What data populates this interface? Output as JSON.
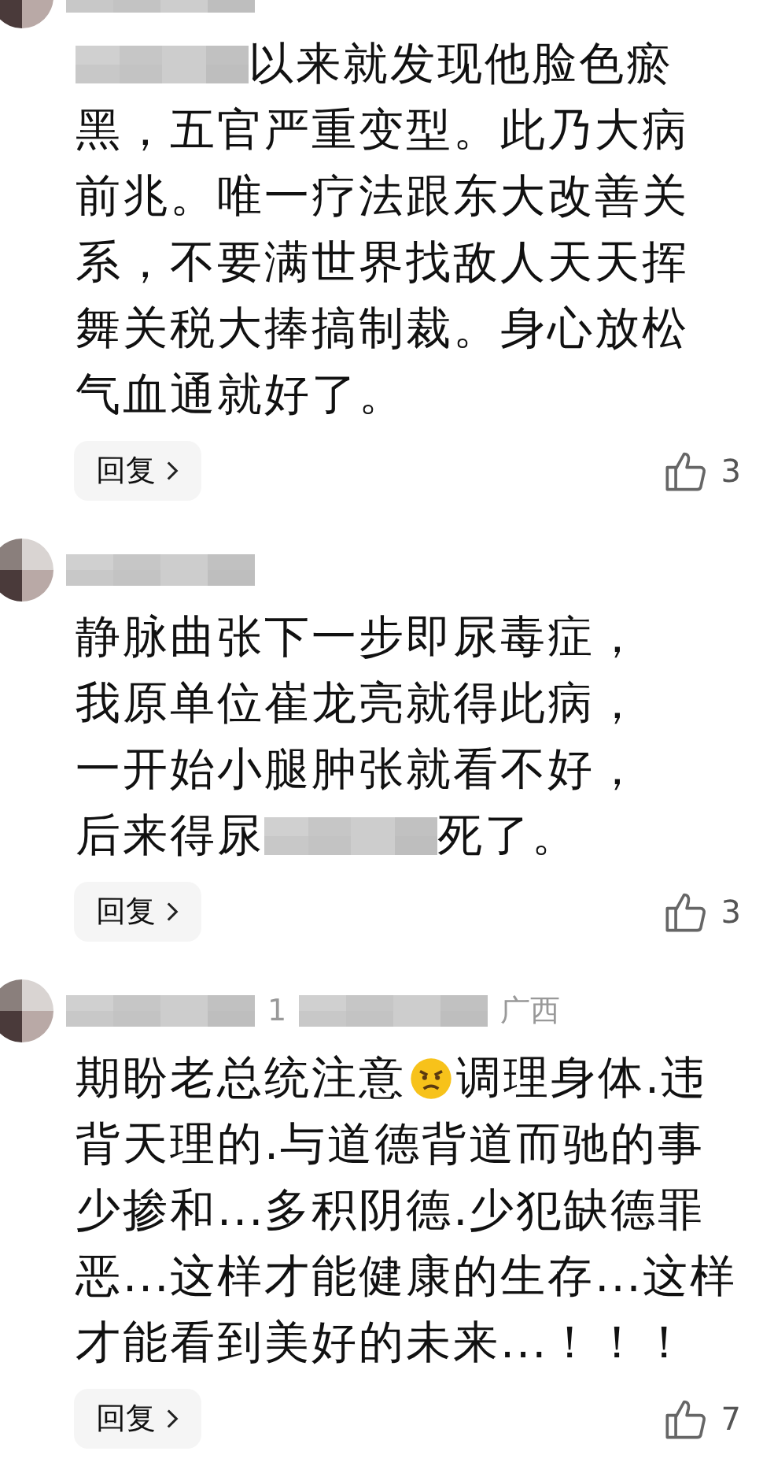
{
  "comments": [
    {
      "header": [
        {
          "kind": "blur"
        }
      ],
      "lines": [
        [
          {
            "kind": "blur"
          },
          {
            "kind": "text",
            "text": "以来就发现他脸色瘀"
          }
        ],
        [
          {
            "kind": "text",
            "text": "黑，五官严重变型。此乃大病"
          }
        ],
        [
          {
            "kind": "text",
            "text": "前兆。唯一疗法跟东大改善关"
          }
        ],
        [
          {
            "kind": "text",
            "text": "系，不要满世界找敌人天天挥"
          }
        ],
        [
          {
            "kind": "text",
            "text": "舞关税大捧搞制裁。身心放松"
          }
        ],
        [
          {
            "kind": "text",
            "text": "气血通就好了。"
          }
        ]
      ],
      "reply": "回复",
      "likes": "3"
    },
    {
      "header": [
        {
          "kind": "blur"
        }
      ],
      "lines": [
        [
          {
            "kind": "text",
            "text": "静脉曲张下一步即尿毒症，"
          }
        ],
        [
          {
            "kind": "text",
            "text": "我原单位崔龙亮就得此病，"
          }
        ],
        [
          {
            "kind": "text",
            "text": "一开始小腿肿张就看不好，"
          }
        ],
        [
          {
            "kind": "text",
            "text": "后来得尿"
          },
          {
            "kind": "blur"
          },
          {
            "kind": "text",
            "text": "死了。"
          }
        ]
      ],
      "reply": "回复",
      "likes": "3"
    },
    {
      "header": [
        {
          "kind": "blur"
        },
        {
          "kind": "text",
          "text": "1"
        },
        {
          "kind": "blur"
        },
        {
          "kind": "text",
          "text": "广西"
        }
      ],
      "lines": [
        [
          {
            "kind": "text",
            "text": "期盼老总统注意"
          },
          {
            "kind": "emoji"
          },
          {
            "kind": "text",
            "text": "调理身体.违"
          }
        ],
        [
          {
            "kind": "text",
            "text": "背天理的.与道德背道而驰的事"
          }
        ],
        [
          {
            "kind": "text",
            "text": "少掺和...多积阴德.少犯缺德罪"
          }
        ],
        [
          {
            "kind": "text",
            "text": "恶...这样才能健康的生存...这样"
          }
        ],
        [
          {
            "kind": "text",
            "text": "才能看到美好的未来...！！！"
          }
        ]
      ],
      "reply": "回复",
      "likes": "7"
    }
  ]
}
